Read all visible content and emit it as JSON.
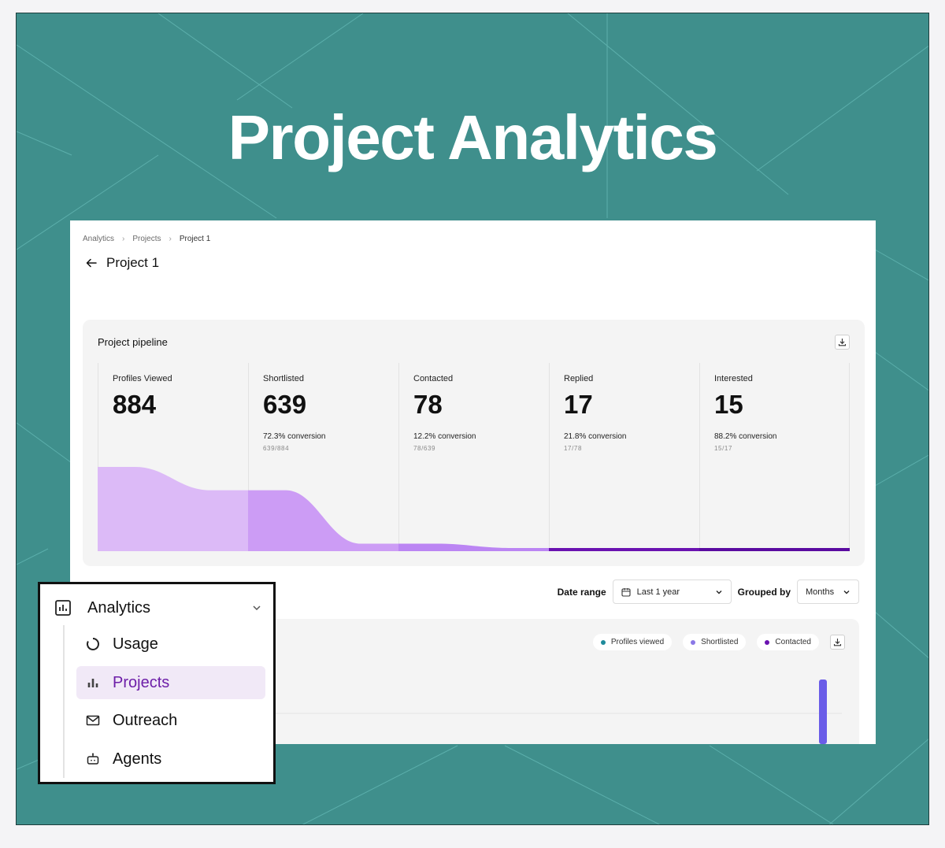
{
  "hero": {
    "title": "Project Analytics"
  },
  "breadcrumb": {
    "items": [
      "Analytics",
      "Projects",
      "Project 1"
    ],
    "separator": "›"
  },
  "header": {
    "back_icon": "arrow-left-icon",
    "title": "Project 1"
  },
  "pipeline": {
    "title": "Project pipeline",
    "download_icon": "download-icon",
    "stages": [
      {
        "label": "Profiles Viewed",
        "value": "884",
        "conversion": "",
        "ratio": ""
      },
      {
        "label": "Shortlisted",
        "value": "639",
        "conversion": "72.3% conversion",
        "ratio": "639/884"
      },
      {
        "label": "Contacted",
        "value": "78",
        "conversion": "12.2% conversion",
        "ratio": "78/639"
      },
      {
        "label": "Replied",
        "value": "17",
        "conversion": "21.8% conversion",
        "ratio": "17/78"
      },
      {
        "label": "Interested",
        "value": "15",
        "conversion": "88.2% conversion",
        "ratio": "15/17"
      }
    ],
    "funnel_values": [
      884,
      639,
      78,
      17,
      15
    ],
    "funnel_colors": [
      "#dcbaf7",
      "#cc9cf5",
      "#bb85f3",
      "#6a12b0",
      "#5a0aa0"
    ]
  },
  "filters": {
    "date_label": "Date range",
    "date_value": "Last 1 year",
    "date_icon": "calendar-icon",
    "group_label": "Grouped by",
    "group_value": "Months",
    "chevron_icon": "chevron-down-icon"
  },
  "chart": {
    "legend": [
      {
        "name": "Profiles viewed",
        "color": "#1e8a9b"
      },
      {
        "name": "Shortlisted",
        "color": "#8a78e6"
      },
      {
        "name": "Contacted",
        "color": "#6a12b0"
      }
    ],
    "download_icon": "download-icon",
    "bar_color": "#6a5ce8"
  },
  "menu": {
    "header": {
      "label": "Analytics",
      "icon": "analytics-icon",
      "chevron_icon": "chevron-down-icon"
    },
    "items": [
      {
        "label": "Usage",
        "icon": "usage-icon",
        "active": false
      },
      {
        "label": "Projects",
        "icon": "projects-icon",
        "active": true
      },
      {
        "label": "Outreach",
        "icon": "mail-icon",
        "active": false
      },
      {
        "label": "Agents",
        "icon": "agents-icon",
        "active": false
      }
    ],
    "active_color": "#6d1ea8"
  },
  "colors": {
    "background": "#3f8f8c",
    "pattern_line": "#7fd6d2"
  }
}
